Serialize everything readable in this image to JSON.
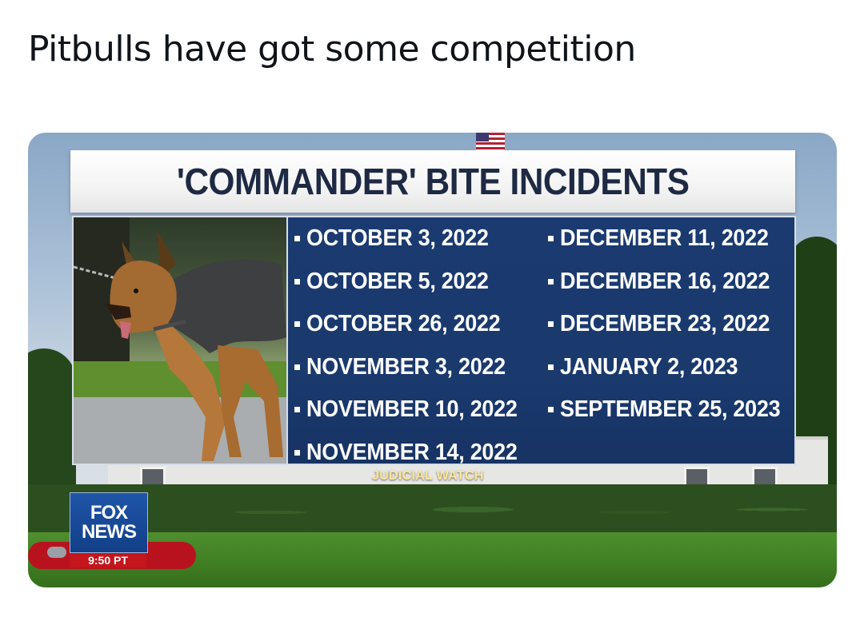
{
  "post": {
    "caption": "Pitbulls have got some competition"
  },
  "graphic": {
    "title": "'COMMANDER' BITE INCIDENTS",
    "incidents_left": [
      "OCTOBER 3, 2022",
      "OCTOBER 5, 2022",
      "OCTOBER 26, 2022",
      "NOVEMBER 3, 2022",
      "NOVEMBER 10, 2022",
      "NOVEMBER 14, 2022"
    ],
    "incidents_right": [
      "DECEMBER 11, 2022",
      "DECEMBER 16, 2022",
      "DECEMBER 23, 2022",
      "JANUARY 2, 2023",
      "SEPTEMBER 25, 2023"
    ],
    "source": "JUDICIAL WATCH",
    "panel_color": "#1a3a6e"
  },
  "network": {
    "logo_line1": "FOX",
    "logo_line2": "NEWS",
    "time": "9:50 PT",
    "brand_color": "#123f88",
    "time_color": "#c4161c"
  }
}
